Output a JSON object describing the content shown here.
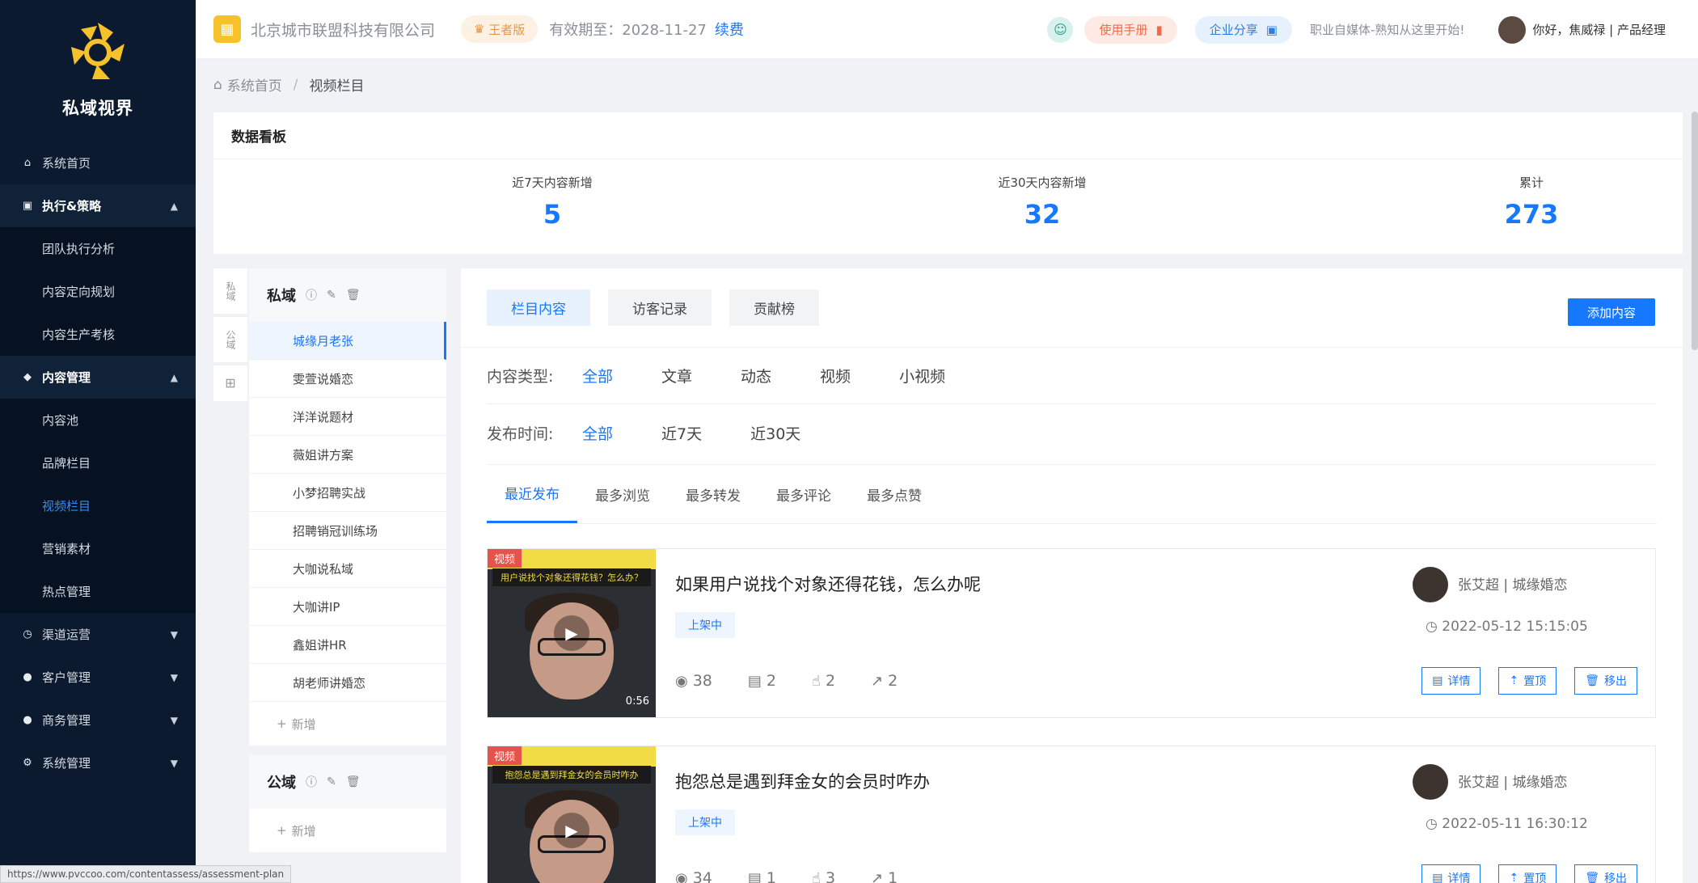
{
  "app": {
    "name": "私域视界"
  },
  "sidebar": {
    "items": [
      {
        "label": "系统首页",
        "type": "item"
      },
      {
        "label": "执行&策略",
        "type": "group",
        "expanded": true
      },
      {
        "label": "团队执行分析",
        "type": "sub"
      },
      {
        "label": "内容定向规划",
        "type": "sub"
      },
      {
        "label": "内容生产考核",
        "type": "sub"
      },
      {
        "label": "内容管理",
        "type": "group",
        "expanded": true
      },
      {
        "label": "内容池",
        "type": "sub"
      },
      {
        "label": "品牌栏目",
        "type": "sub"
      },
      {
        "label": "视频栏目",
        "type": "sub",
        "active": true
      },
      {
        "label": "营销素材",
        "type": "sub"
      },
      {
        "label": "热点管理",
        "type": "sub"
      },
      {
        "label": "渠道运营",
        "type": "item"
      },
      {
        "label": "客户管理",
        "type": "item"
      },
      {
        "label": "商务管理",
        "type": "item"
      },
      {
        "label": "系统管理",
        "type": "item"
      }
    ]
  },
  "header": {
    "company": "北京城市联盟科技有限公司",
    "edition": "王者版",
    "validity": "有效期至：2028-11-27",
    "renew": "续费",
    "manual": "使用手册",
    "share": "企业分享",
    "slogan": "职业自媒体-熟知从这里开始!",
    "user": "你好，焦威禄 | 产品经理"
  },
  "breadcrumb": {
    "home": "系统首页",
    "current": "视频栏目"
  },
  "dashboard": {
    "title": "数据看板",
    "stats": [
      {
        "label": "近7天内容新增",
        "value": "5"
      },
      {
        "label": "近30天内容新增",
        "value": "32"
      },
      {
        "label": "累计",
        "value": "273"
      }
    ]
  },
  "vtabs": {
    "private": "私域",
    "public": "公域"
  },
  "columns": {
    "private": {
      "name": "私域",
      "items": [
        "城缘月老张",
        "雯萱说婚恋",
        "洋洋说题材",
        "薇姐讲方案",
        "小梦招聘实战",
        "招聘销冠训练场",
        "大咖说私域",
        "大咖讲IP",
        "鑫姐讲HR",
        "胡老师讲婚恋"
      ],
      "add": "新增"
    },
    "public": {
      "name": "公域",
      "add": "新增"
    }
  },
  "main": {
    "tabs": [
      "栏目内容",
      "访客记录",
      "贡献榜"
    ],
    "add_button": "添加内容",
    "type_label": "内容类型:",
    "types": [
      "全部",
      "文章",
      "动态",
      "视频",
      "小视频"
    ],
    "time_label": "发布时间:",
    "times": [
      "全部",
      "近7天",
      "近30天"
    ],
    "sorts": [
      "最近发布",
      "最多浏览",
      "最多转发",
      "最多评论",
      "最多点赞"
    ]
  },
  "cards": [
    {
      "tag": "视频",
      "caption": "用户说找个对象还得花钱？怎么办？",
      "duration": "0:56",
      "title": "如果用户说找个对象还得花钱，怎么办呢",
      "status": "上架中",
      "views": "38",
      "comments": "2",
      "likes": "2",
      "shares": "2",
      "author": "张艾超 | 城缘婚恋",
      "date": "2022-05-12 15:15:05",
      "actions": [
        "详情",
        "置顶",
        "移出"
      ]
    },
    {
      "tag": "视频",
      "caption": "抱怨总是遇到拜金女的会员时咋办",
      "duration": "",
      "title": "抱怨总是遇到拜金女的会员时咋办",
      "status": "上架中",
      "views": "34",
      "comments": "1",
      "likes": "3",
      "shares": "1",
      "author": "张艾超 | 城缘婚恋",
      "date": "2022-05-11 16:30:12",
      "actions": [
        "详情",
        "置顶",
        "移出"
      ]
    }
  ],
  "statusbar": "https://www.pvccoo.com/contentassess/assessment-plan",
  "colors": {
    "accent": "#1677ff",
    "sidebar": "#0b1a2e"
  }
}
